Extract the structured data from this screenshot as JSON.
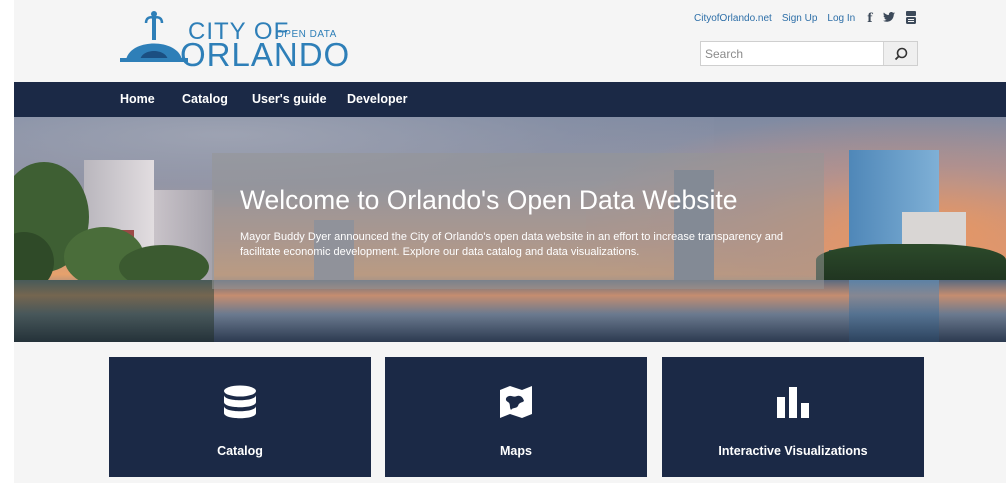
{
  "brand": {
    "city": "CITY OF",
    "open_data": "OPEN DATA",
    "orlando": "ORLANDO",
    "color": "#2e7fb8"
  },
  "top_links": {
    "site": "CityofOrlando.net",
    "signup": "Sign Up",
    "login": "Log In"
  },
  "social": {
    "facebook": "f",
    "twitter": "🐦",
    "youtube": "You Tube",
    "icons": [
      "facebook-icon",
      "twitter-icon",
      "youtube-icon"
    ]
  },
  "search": {
    "placeholder": "Search",
    "value": "",
    "icon": "search-icon"
  },
  "nav": {
    "items": [
      "Home",
      "Catalog",
      "User's guide",
      "Developer"
    ],
    "background": "#1b2946"
  },
  "hero": {
    "title": "Welcome to Orlando's Open Data Website",
    "text": "Mayor Buddy Dyer announced the City of Orlando's open data website in an effort to increase transparency and facilitate economic development. Explore our data catalog and data visualizations."
  },
  "tiles": [
    {
      "label": "Catalog",
      "icon": "database-icon"
    },
    {
      "label": "Maps",
      "icon": "map-icon"
    },
    {
      "label": "Interactive Visualizations",
      "icon": "bar-chart-icon"
    }
  ]
}
